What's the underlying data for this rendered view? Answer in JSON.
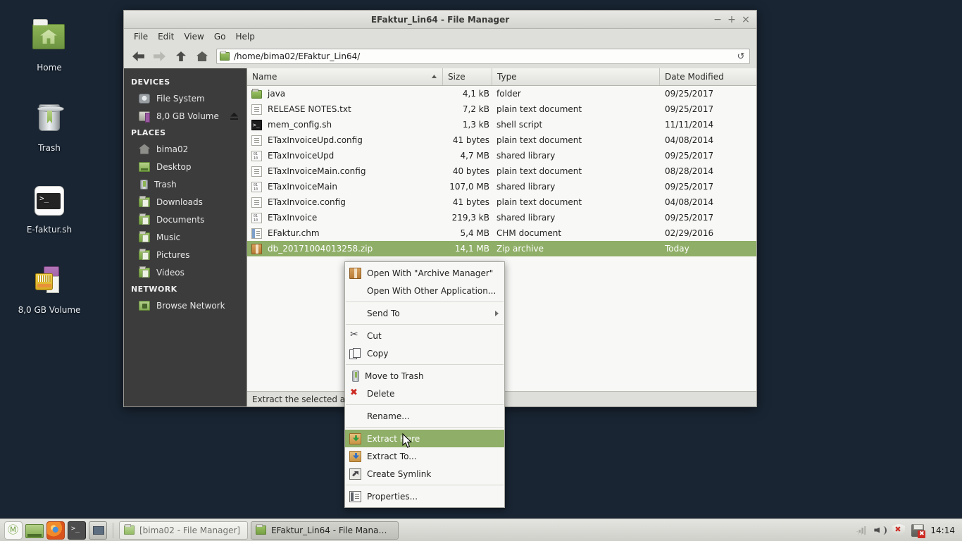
{
  "desktop": {
    "background_color": "#192533",
    "icons": [
      {
        "label": "Home",
        "icon": "home-folder-icon"
      },
      {
        "label": "Trash",
        "icon": "trash-icon"
      },
      {
        "label": "E-faktur.sh",
        "icon": "shell-script-icon"
      },
      {
        "label": "8,0 GB Volume",
        "icon": "removable-volume-icon"
      }
    ]
  },
  "window": {
    "title": "EFaktur_Lin64 - File Manager",
    "controls": {
      "minimize": "−",
      "maximize": "+",
      "close": "×"
    },
    "menubar": [
      "File",
      "Edit",
      "View",
      "Go",
      "Help"
    ],
    "toolbar": {
      "back_icon": "arrow-left-icon",
      "forward_icon": "arrow-right-icon",
      "up_icon": "arrow-up-icon",
      "home_icon": "home-icon",
      "path": "/home/bima02/EFaktur_Lin64/",
      "reload_icon": "reload-icon",
      "reload_glyph": "↺"
    },
    "statusbar": "Extract the selected arch"
  },
  "sidebar": {
    "background_color": "#3c3c3c",
    "groups": [
      {
        "title": "DEVICES",
        "items": [
          {
            "label": "File System",
            "icon": "hard-disk-icon",
            "eject": false
          },
          {
            "label": "8,0 GB Volume",
            "icon": "usb-volume-icon",
            "eject": true
          }
        ]
      },
      {
        "title": "PLACES",
        "items": [
          {
            "label": "bima02",
            "icon": "home-icon",
            "eject": false
          },
          {
            "label": "Desktop",
            "icon": "desktop-folder-icon",
            "eject": false
          },
          {
            "label": "Trash",
            "icon": "trash-icon",
            "eject": false
          },
          {
            "label": "Downloads",
            "icon": "downloads-folder-icon",
            "eject": false
          },
          {
            "label": "Documents",
            "icon": "documents-folder-icon",
            "eject": false
          },
          {
            "label": "Music",
            "icon": "music-folder-icon",
            "eject": false
          },
          {
            "label": "Pictures",
            "icon": "pictures-folder-icon",
            "eject": false
          },
          {
            "label": "Videos",
            "icon": "videos-folder-icon",
            "eject": false
          }
        ]
      },
      {
        "title": "NETWORK",
        "items": [
          {
            "label": "Browse Network",
            "icon": "network-folder-icon",
            "eject": false
          }
        ]
      }
    ]
  },
  "filelist": {
    "columns": [
      "Name",
      "Size",
      "Type",
      "Date Modified"
    ],
    "sorted_by": "Name",
    "sort_direction": "ascending",
    "selection_color": "#8fae67",
    "rows": [
      {
        "name": "java",
        "size": "4,1 kB",
        "type": "folder",
        "date": "09/25/2017",
        "icon": "folder-icon",
        "selected": false
      },
      {
        "name": "RELEASE NOTES.txt",
        "size": "7,2 kB",
        "type": "plain text document",
        "date": "09/25/2017",
        "icon": "text-file-icon",
        "selected": false
      },
      {
        "name": "mem_config.sh",
        "size": "1,3 kB",
        "type": "shell script",
        "date": "11/11/2014",
        "icon": "shell-script-icon",
        "selected": false
      },
      {
        "name": "ETaxInvoiceUpd.config",
        "size": "41 bytes",
        "type": "plain text document",
        "date": "04/08/2014",
        "icon": "text-file-icon",
        "selected": false
      },
      {
        "name": "ETaxInvoiceUpd",
        "size": "4,7 MB",
        "type": "shared library",
        "date": "09/25/2017",
        "icon": "binary-file-icon",
        "selected": false
      },
      {
        "name": "ETaxInvoiceMain.config",
        "size": "40 bytes",
        "type": "plain text document",
        "date": "08/28/2014",
        "icon": "text-file-icon",
        "selected": false
      },
      {
        "name": "ETaxInvoiceMain",
        "size": "107,0 MB",
        "type": "shared library",
        "date": "09/25/2017",
        "icon": "binary-file-icon",
        "selected": false
      },
      {
        "name": "ETaxInvoice.config",
        "size": "41 bytes",
        "type": "plain text document",
        "date": "04/08/2014",
        "icon": "text-file-icon",
        "selected": false
      },
      {
        "name": "ETaxInvoice",
        "size": "219,3 kB",
        "type": "shared library",
        "date": "09/25/2017",
        "icon": "binary-file-icon",
        "selected": false
      },
      {
        "name": "EFaktur.chm",
        "size": "5,4 MB",
        "type": "CHM document",
        "date": "02/29/2016",
        "icon": "chm-file-icon",
        "selected": false
      },
      {
        "name": "db_20171004013258.zip",
        "size": "14,1 MB",
        "type": "Zip archive",
        "date": "Today",
        "icon": "zip-file-icon",
        "selected": true
      }
    ]
  },
  "context_menu": {
    "highlight_color": "#8fae67",
    "items": [
      {
        "label": "Open With \"Archive Manager\"",
        "icon": "archive-manager-icon",
        "type": "item",
        "highlighted": false,
        "submenu": false
      },
      {
        "label": "Open With Other Application...",
        "icon": "none",
        "type": "item",
        "highlighted": false,
        "submenu": false
      },
      {
        "type": "separator"
      },
      {
        "label": "Send To",
        "icon": "none",
        "type": "item",
        "highlighted": false,
        "submenu": true
      },
      {
        "type": "separator"
      },
      {
        "label": "Cut",
        "icon": "scissors-icon",
        "type": "item",
        "highlighted": false,
        "submenu": false
      },
      {
        "label": "Copy",
        "icon": "copy-icon",
        "type": "item",
        "highlighted": false,
        "submenu": false
      },
      {
        "type": "separator"
      },
      {
        "label": "Move to Trash",
        "icon": "trash-icon",
        "type": "item",
        "highlighted": false,
        "submenu": false
      },
      {
        "label": "Delete",
        "icon": "delete-x-icon",
        "type": "item",
        "highlighted": false,
        "submenu": false
      },
      {
        "type": "separator"
      },
      {
        "label": "Rename...",
        "icon": "none",
        "type": "item",
        "highlighted": false,
        "submenu": false
      },
      {
        "type": "separator"
      },
      {
        "label": "Extract Here",
        "icon": "extract-here-icon",
        "type": "item",
        "highlighted": true,
        "submenu": false
      },
      {
        "label": "Extract To...",
        "icon": "extract-to-icon",
        "type": "item",
        "highlighted": false,
        "submenu": false
      },
      {
        "label": "Create Symlink",
        "icon": "symlink-icon",
        "type": "item",
        "highlighted": false,
        "submenu": false
      },
      {
        "type": "separator"
      },
      {
        "label": "Properties...",
        "icon": "properties-icon",
        "type": "item",
        "highlighted": false,
        "submenu": false
      }
    ]
  },
  "taskbar": {
    "launchers": [
      {
        "name": "mint-menu-icon"
      },
      {
        "name": "file-manager-icon"
      },
      {
        "name": "firefox-icon"
      },
      {
        "name": "terminal-icon"
      },
      {
        "name": "show-desktop-icon"
      }
    ],
    "windows": [
      {
        "label": "[bima02 - File Manager]",
        "active": false
      },
      {
        "label": "EFaktur_Lin64 - File Manager",
        "active": true
      }
    ],
    "tray": [
      {
        "name": "network-signal-icon"
      },
      {
        "name": "volume-icon"
      },
      {
        "name": "security-shield-icon"
      },
      {
        "name": "printer-icon"
      }
    ],
    "clock": "14:14"
  }
}
